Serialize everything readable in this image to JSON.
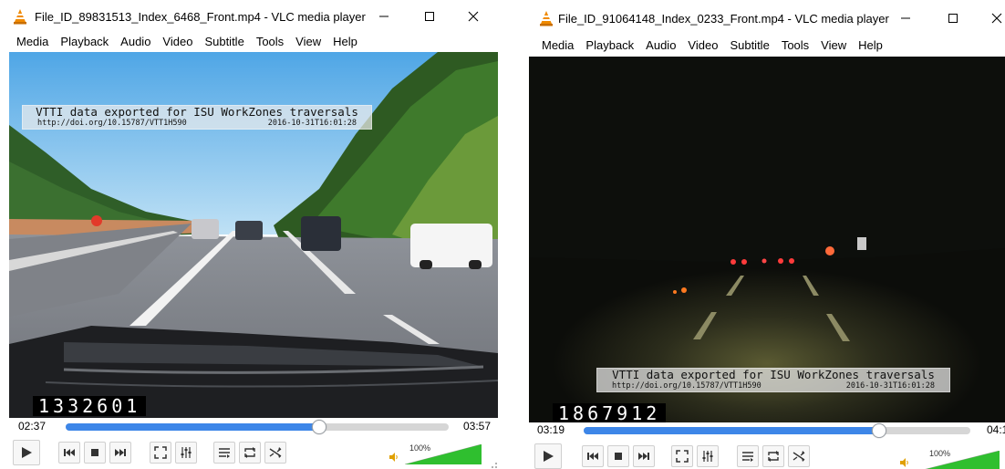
{
  "windows": [
    {
      "title": "File_ID_89831513_Index_6468_Front.mp4 - VLC media player",
      "menu": [
        "Media",
        "Playback",
        "Audio",
        "Video",
        "Subtitle",
        "Tools",
        "View",
        "Help"
      ],
      "overlay": {
        "line1": "VTTI data exported for ISU WorkZones traversals",
        "url": "http://doi.org/10.15787/VTT1H590",
        "timestamp": "2016-10-31T16:01:28"
      },
      "frame_counter": "1332601",
      "scene": "day",
      "elapsed": "02:37",
      "total": "03:57",
      "progress": 0.66,
      "volume_label": "100%",
      "volume_level": 1.0
    },
    {
      "title": "File_ID_91064148_Index_0233_Front.mp4 - VLC media player",
      "menu": [
        "Media",
        "Playback",
        "Audio",
        "Video",
        "Subtitle",
        "Tools",
        "View",
        "Help"
      ],
      "overlay": {
        "line1": "VTTI data exported for ISU WorkZones traversals",
        "url": "http://doi.org/10.15787/VTT1H590",
        "timestamp": "2016-10-31T16:01:28"
      },
      "frame_counter": "1867912",
      "scene": "night",
      "elapsed": "03:19",
      "total": "04:1",
      "progress": 0.76,
      "volume_label": "100%",
      "volume_level": 1.0
    }
  ],
  "icons": {
    "app": "vlc-cone-icon",
    "minimize": "minimize-icon",
    "maximize": "maximize-icon",
    "close": "close-icon",
    "play": "play-icon",
    "previous": "previous-icon",
    "stop": "stop-icon",
    "next": "next-icon",
    "fullscreen": "fullscreen-icon",
    "extended": "extended-settings-icon",
    "playlist": "playlist-icon",
    "loop": "loop-icon",
    "random": "random-icon",
    "volume": "volume-icon"
  },
  "colors": {
    "accent": "#3d86e8",
    "vlc_orange": "#f08a00",
    "volume_green": "#2fbf2f"
  }
}
